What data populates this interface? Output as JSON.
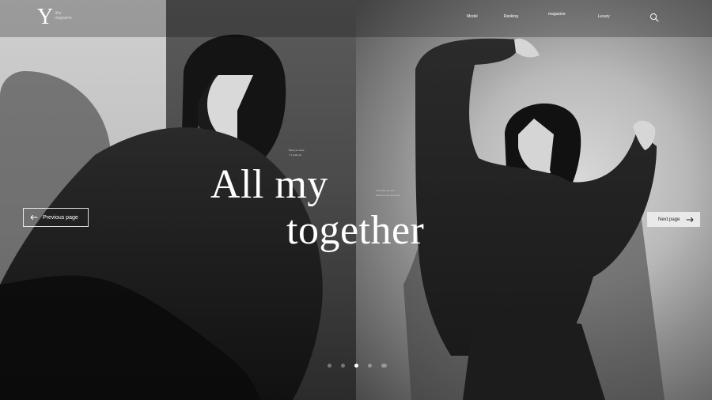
{
  "brand": {
    "logo_mark": "Y",
    "logo_text_1": "Ithe",
    "logo_text_2": "magazine"
  },
  "nav": {
    "items": [
      "Model",
      "Ranking",
      "magazine",
      "Luxury"
    ]
  },
  "hero": {
    "title_line_1": "All my",
    "title_line_2": "together",
    "note_1": "Being so close",
    "note_2": "Y it walk par",
    "note_3": "It feel like you are",
    "note_4": "with your one and only"
  },
  "controls": {
    "prev_label": "Previous page",
    "next_label": "Next page",
    "page_dots": 5,
    "active_dot_index": 2
  },
  "colors": {
    "overlay": "#000000",
    "text": "#ffffff",
    "next_button_bg": "#e9e9e9"
  },
  "icons": {
    "search": "search-icon",
    "prev_arrow": "arrow-left-icon",
    "next_arrow": "arrow-right-icon"
  }
}
